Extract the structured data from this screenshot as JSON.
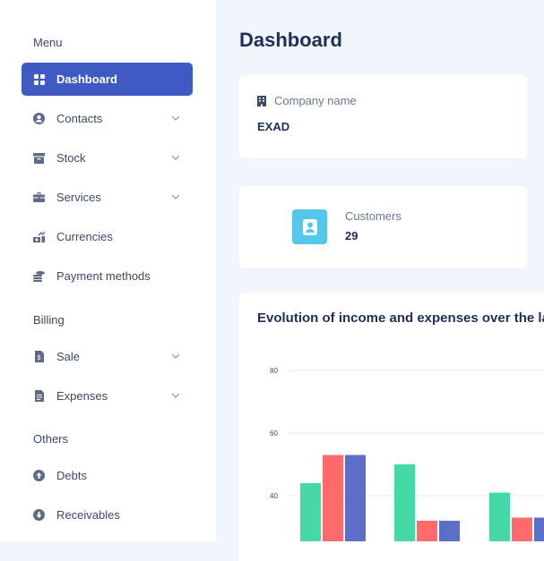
{
  "sidebar": {
    "sections": {
      "menu": "Menu",
      "billing": "Billing",
      "others": "Others"
    },
    "items": [
      {
        "label": "Dashboard",
        "icon": "grid-icon",
        "active": true
      },
      {
        "label": "Contacts",
        "icon": "user-circle-icon",
        "expandable": true
      },
      {
        "label": "Stock",
        "icon": "archive-box-icon",
        "expandable": true
      },
      {
        "label": "Services",
        "icon": "toolbox-icon",
        "expandable": true
      },
      {
        "label": "Currencies",
        "icon": "money-chart-icon"
      },
      {
        "label": "Payment methods",
        "icon": "coins-icon"
      },
      {
        "label": "Sale",
        "icon": "invoice-icon",
        "expandable": true
      },
      {
        "label": "Expenses",
        "icon": "receipt-icon",
        "expandable": true
      },
      {
        "label": "Debts",
        "icon": "arrow-up-circle-icon"
      },
      {
        "label": "Receivables",
        "icon": "arrow-down-circle-icon"
      }
    ]
  },
  "main": {
    "title": "Dashboard",
    "company": {
      "label": "Company name",
      "value": "EXAD"
    },
    "customers": {
      "label": "Customers",
      "value": "29"
    },
    "chart_title": "Evolution of income and expenses over the la"
  },
  "colors": {
    "accent": "#3f5ac2",
    "series_green": "#45d9a8",
    "series_red": "#ff6b6b",
    "series_blue": "#5b6fc9",
    "customer_tile": "#55c7ea"
  },
  "chart_data": {
    "type": "bar",
    "title": "Evolution of income and expenses over the la",
    "categories": [
      "",
      "",
      ""
    ],
    "series": [
      {
        "color": "#45d9a8",
        "values": [
          44,
          50,
          41
        ]
      },
      {
        "color": "#ff6b6b",
        "values": [
          53,
          32,
          33
        ]
      },
      {
        "color": "#5b6fc9",
        "values": [
          53,
          32,
          33
        ]
      }
    ],
    "yticks": [
      40,
      60,
      80
    ],
    "ylim": [
      20,
      80
    ],
    "grid": true
  }
}
